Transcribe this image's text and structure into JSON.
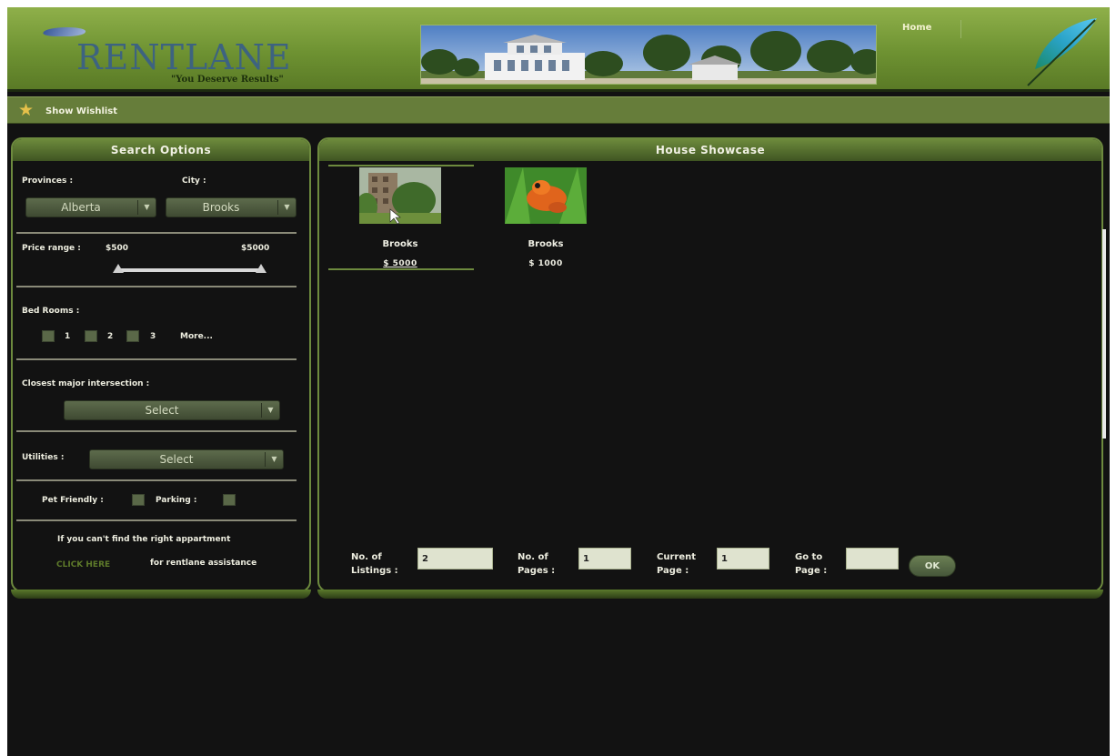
{
  "header": {
    "logo_title": "RENTLANE",
    "logo_tagline": "\"You Deserve Results\"",
    "nav_home": "Home"
  },
  "wishbar": {
    "label": "Show Wishlist",
    "icon": "star-icon"
  },
  "search": {
    "title": "Search Options",
    "provinces_label": "Provinces :",
    "city_label": "City :",
    "province_value": "Alberta",
    "city_value": "Brooks",
    "price_label": "Price range :",
    "price_min": "$500",
    "price_max": "$5000",
    "bedrooms_label": "Bed Rooms :",
    "bedroom_options": [
      "1",
      "2",
      "3"
    ],
    "bedroom_more": "More...",
    "intersection_label": "Closest major intersection :",
    "intersection_value": "Select",
    "utilities_label": "Utilities :",
    "utilities_value": "Select",
    "pet_label": "Pet Friendly :",
    "parking_label": "Parking :",
    "help_text": "If you can't find the right appartment",
    "click_here": "CLICK HERE",
    "assist_text": "for rentlane assistance"
  },
  "showcase": {
    "title": "House Showcase",
    "listings": [
      {
        "city": "Brooks",
        "price": "$ 5000"
      },
      {
        "city": "Brooks",
        "price": "$ 1000"
      }
    ],
    "pagination": {
      "listings_label": [
        "No. of",
        "Listings :"
      ],
      "listings_value": "2",
      "pages_label": [
        "No. of",
        "Pages :"
      ],
      "pages_value": "1",
      "current_label": [
        "Current",
        "Page :"
      ],
      "current_value": "1",
      "goto_label": [
        "Go to",
        "Page :"
      ],
      "goto_value": "",
      "ok_label": "OK"
    }
  },
  "colors": {
    "header_green": "#6e9232",
    "panel_border": "#6d8a3e",
    "background": "#121212",
    "wishbar": "#667d3a"
  }
}
